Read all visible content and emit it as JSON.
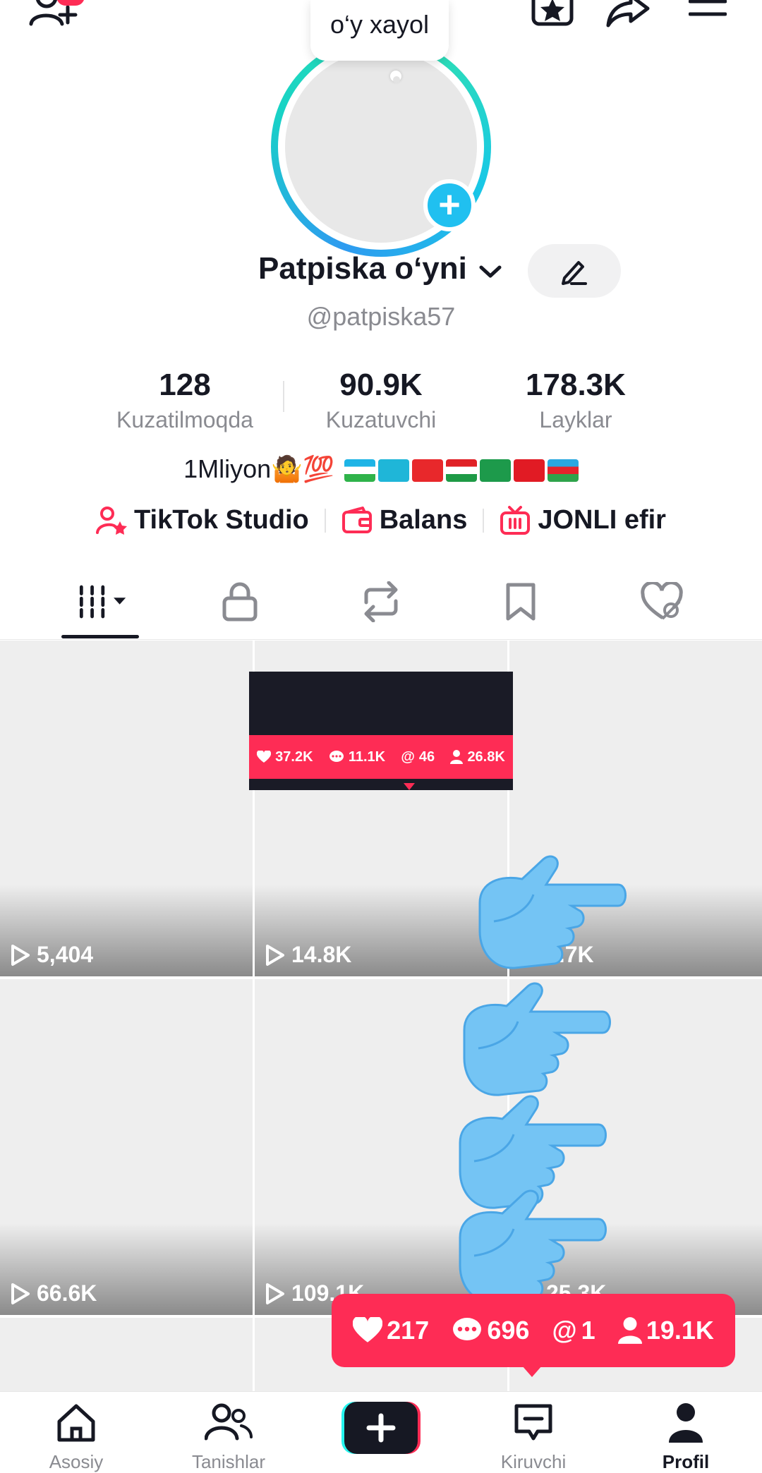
{
  "note": {
    "text": "o‘y xayol"
  },
  "profile": {
    "name": "Patpiska o‘yni",
    "handle": "@patpiska57",
    "bio_text": "1Mliyon🤷💯"
  },
  "stats": [
    {
      "value": "128",
      "label": "Kuzatilmoqda"
    },
    {
      "value": "90.9K",
      "label": "Kuzatuvchi"
    },
    {
      "value": "178.3K",
      "label": "Layklar"
    }
  ],
  "links": [
    {
      "label": "TikTok Studio",
      "icon": "person-star-icon"
    },
    {
      "label": "Balans",
      "icon": "wallet-icon"
    },
    {
      "label": "JONLI efir",
      "icon": "live-tv-icon"
    }
  ],
  "tabs": [
    {
      "icon": "grid-icon"
    },
    {
      "icon": "lock-icon"
    },
    {
      "icon": "repost-icon"
    },
    {
      "icon": "bookmark-icon"
    },
    {
      "icon": "liked-hidden-icon"
    }
  ],
  "videos": [
    {
      "views": "5,404"
    },
    {
      "views": "14.8K"
    },
    {
      "views": "1.7K"
    },
    {
      "views": "66.6K"
    },
    {
      "views": "109.1K"
    },
    {
      "views": "25.3K"
    }
  ],
  "popup_small": {
    "likes": "37.2K",
    "comments": "11.1K",
    "mentions": "46",
    "followers": "26.8K"
  },
  "popup_big": {
    "likes": "217",
    "comments": "696",
    "mentions": "1",
    "followers": "19.1K"
  },
  "nav": [
    {
      "label": "Asosiy",
      "icon": "home-icon"
    },
    {
      "label": "Tanishlar",
      "icon": "friends-icon"
    },
    {
      "label": "",
      "icon": "create-plus-icon"
    },
    {
      "label": "Kiruvchi",
      "icon": "inbox-icon"
    },
    {
      "label": "Profil",
      "icon": "profile-icon"
    }
  ],
  "colors": {
    "accent": "#fe2c55",
    "ring_blue": "#2e9bf0",
    "ring_teal": "#18d3c5",
    "plus_blue": "#20c0f0",
    "text_primary": "#161823",
    "text_secondary": "#8a8b91"
  }
}
